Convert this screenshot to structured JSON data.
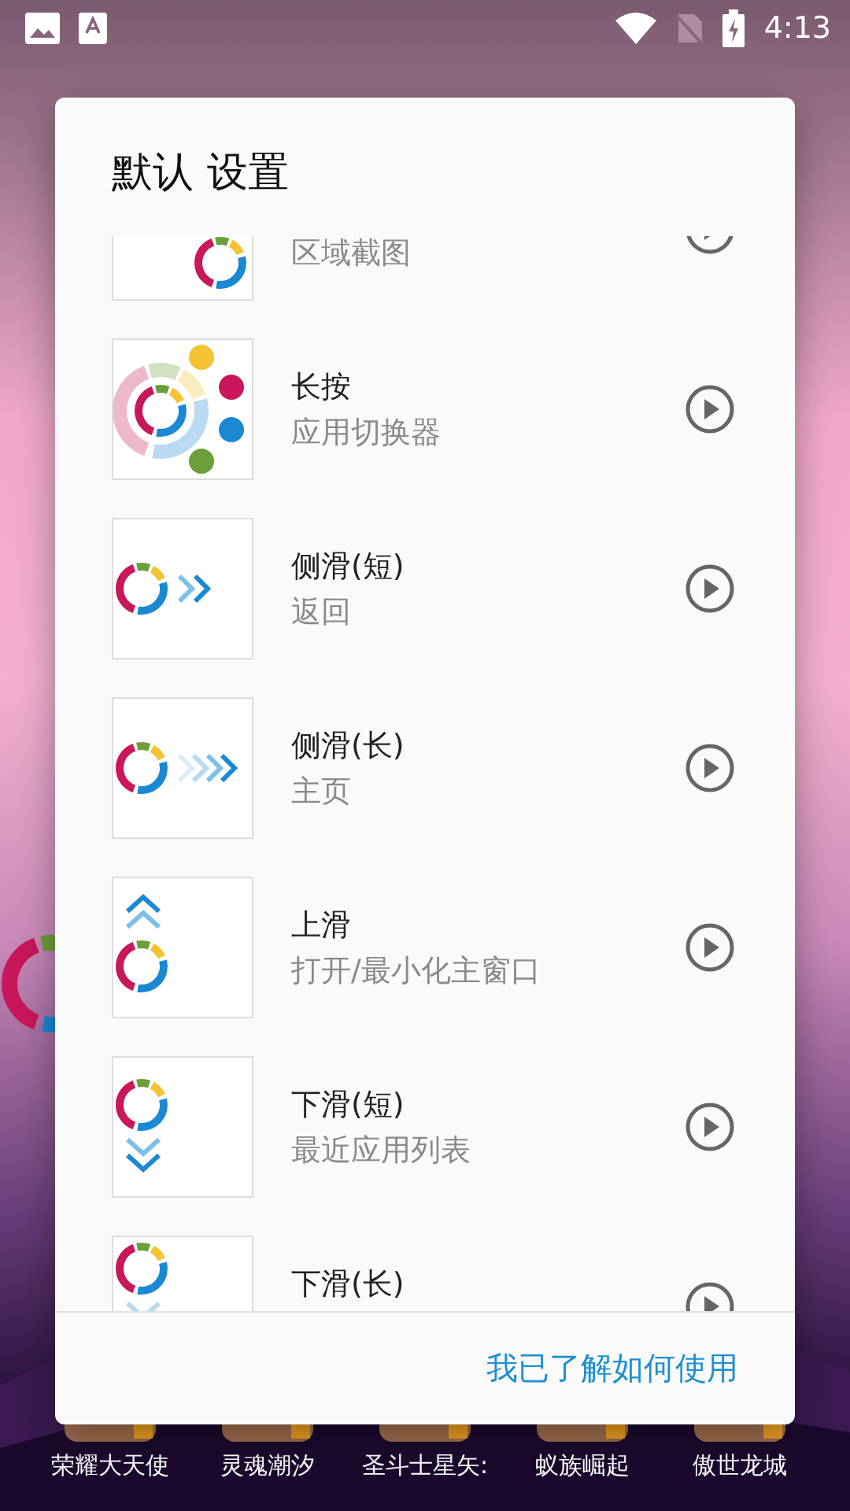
{
  "status_bar": {
    "time": "4:13"
  },
  "dialog": {
    "title": "默认 设置",
    "items": [
      {
        "kind": "crop",
        "subtitle": "区域截图"
      },
      {
        "kind": "apps",
        "title": "长按",
        "subtitle": "应用切换器"
      },
      {
        "kind": "back",
        "title": "侧滑(短)",
        "subtitle": "返回"
      },
      {
        "kind": "home",
        "title": "侧滑(长)",
        "subtitle": "主页"
      },
      {
        "kind": "up",
        "title": "上滑",
        "subtitle": "打开/最小化主窗口"
      },
      {
        "kind": "down",
        "title": "下滑(短)",
        "subtitle": "最近应用列表"
      },
      {
        "kind": "downlong",
        "title": "下滑(长)"
      }
    ],
    "confirm": "我已了解如何使用"
  },
  "home_apps": [
    {
      "label": "荣耀大天使"
    },
    {
      "label": "灵魂潮汐"
    },
    {
      "label": "圣斗士星矢:"
    },
    {
      "label": "蚁族崛起"
    },
    {
      "label": "傲世龙城"
    }
  ]
}
